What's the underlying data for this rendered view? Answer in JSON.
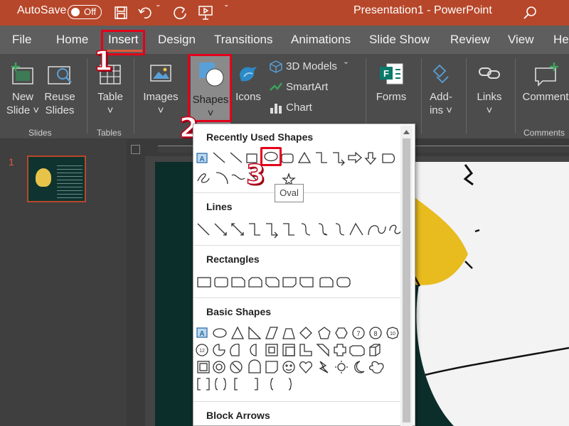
{
  "titlebar": {
    "autosave_label": "AutoSave",
    "autosave_state": "Off",
    "document_title": "Presentation1  -  PowerPoint"
  },
  "tabs": [
    "File",
    "Home",
    "Insert",
    "Design",
    "Transitions",
    "Animations",
    "Slide Show",
    "Review",
    "View",
    "He"
  ],
  "ribbon": {
    "new_slide": [
      "New",
      "Slide ˅"
    ],
    "reuse_slides": [
      "Reuse",
      "Slides"
    ],
    "table": [
      "Table",
      "˅"
    ],
    "images": [
      "Images",
      "˅"
    ],
    "shapes": [
      "Shapes",
      "˅"
    ],
    "icons": "Icons",
    "models3d": "3D Models",
    "smartart": "SmartArt",
    "chart": "Chart",
    "forms": "Forms",
    "addins": [
      "Add-",
      "ins ˅"
    ],
    "links": [
      "Links",
      "˅"
    ],
    "comment": "Comment",
    "groups": {
      "slides": "Slides",
      "tables": "Tables",
      "comments": "Comments"
    }
  },
  "slide_number": "1",
  "steps": [
    "1",
    "2",
    "3"
  ],
  "dropdown": {
    "recent": "Recently Used Shapes",
    "lines": "Lines",
    "rectangles": "Rectangles",
    "basic": "Basic Shapes",
    "block_arrows": "Block Arrows"
  },
  "tooltip": "Oval",
  "colors": {
    "brand": "#b7472a",
    "highlight": "#e3001b"
  }
}
